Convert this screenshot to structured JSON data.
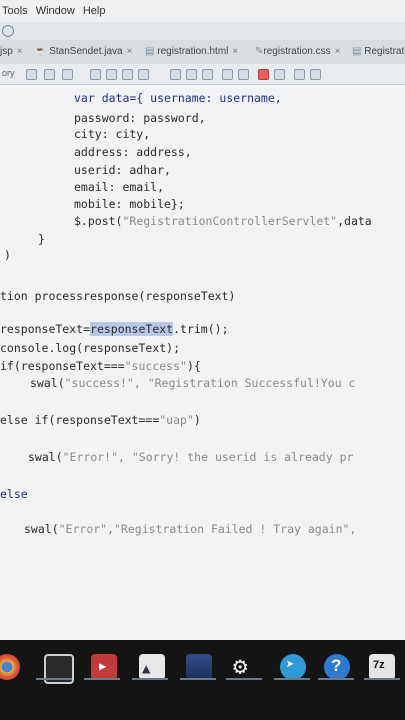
{
  "menu": {
    "items": [
      "Tools",
      "Window",
      "Help"
    ]
  },
  "tabs": [
    {
      "label": "jsp"
    },
    {
      "label": "StanSendet.java"
    },
    {
      "label": "registration.html"
    },
    {
      "label": "registration.css"
    },
    {
      "label": "Registrat"
    }
  ],
  "toolbar": {
    "left_label": "ory"
  },
  "code": {
    "l1": "var data={ username: username,",
    "l2": "password: password,",
    "l3": "city: city,",
    "l4": "address: address,",
    "l5": "userid: adhar,",
    "l6": "email: email,",
    "l7": "mobile: mobile};",
    "l8a": "$.post(",
    "l8b": "\"RegistrationControllerServlet\"",
    "l8c": ",data",
    "l9": "}",
    "l10": ")",
    "l11": "tion processresponse(responseText)",
    "l12a": "responseText=",
    "l12b": "responseText",
    "l12c": ".trim();",
    "l13": "console.log(responseText);",
    "l14a": "if(responseText===",
    "l14b": "\"success\"",
    "l14c": "){",
    "l15a": "swal(",
    "l15b": "\"success!\", \"Registration Successful!You c",
    "l16a": "else if(responseText===",
    "l16b": "\"uap\"",
    "l16c": ")",
    "l17a": "swal(",
    "l17b": "\"Error!\", \"Sorry! the userid is already pr",
    "l18": "else",
    "l19a": "swal(",
    "l19b": "\"Error\",\"Registration Failed ! Tray again\","
  },
  "taskbar": {
    "icons": [
      "chrome-icon",
      "video-editor-icon",
      "media-player-icon",
      "photos-icon",
      "display-icon",
      "settings-icon",
      "telegram-icon",
      "help-icon",
      "7zip-icon"
    ],
    "badge": "7z"
  }
}
